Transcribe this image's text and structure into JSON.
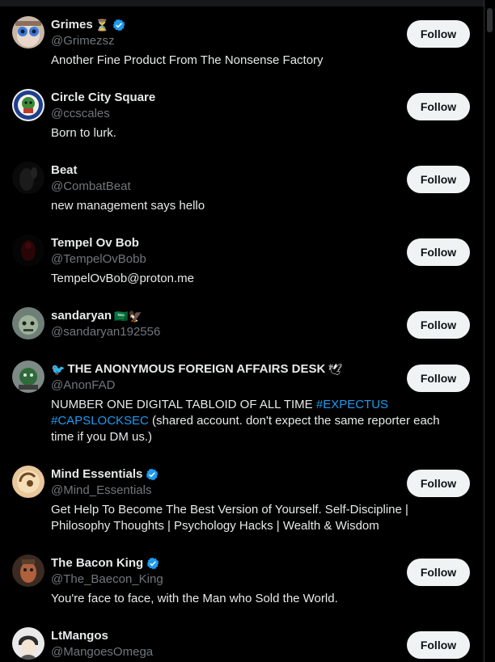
{
  "follow_label": "Follow",
  "colors": {
    "background": "#000000",
    "verified": "#1d9bf0",
    "link": "#1d9bf0",
    "handle": "#71767b",
    "button_bg": "#eff3f4"
  },
  "users": [
    {
      "name": "Grimes",
      "emoji_after": "⏳",
      "verified": true,
      "handle": "@Grimezsz",
      "bio": "Another Fine Product From The Nonsense Factory"
    },
    {
      "name": "Circle City Square",
      "verified": false,
      "handle": "@ccscales",
      "bio": "Born to lurk."
    },
    {
      "name": "Beat",
      "verified": false,
      "handle": "@CombatBeat",
      "bio": "new management says hello"
    },
    {
      "name": "Tempel Ov Bob",
      "verified": false,
      "handle": "@TempelOvBobb",
      "bio": "TempelOvBob@proton.me"
    },
    {
      "name": "sandaryan",
      "emoji_after": "🇸🇦🦅",
      "verified": false,
      "handle": "@sandaryan192556",
      "bio": ""
    },
    {
      "name": "THE ANONYMOUS FOREIGN AFFAIRS DESK",
      "emoji_before": "🐦",
      "emoji_after": "🕊",
      "verified": false,
      "handle": "@AnonFAD",
      "bio_parts": [
        "NUMBER ONE DIGITAL TABLOID OF ALL TIME ",
        "#EXPECTUS",
        " ",
        "#CAPSLOCKSEC",
        " (shared account. don't expect the same reporter each time if you DM us.)"
      ]
    },
    {
      "name": "Mind Essentials",
      "verified": true,
      "handle": "@Mind_Essentials",
      "bio": "Get Help To Become The Best Version of Yourself. Self-Discipline | Philosophy Thoughts | Psychology Hacks | Wealth & Wisdom"
    },
    {
      "name": "The Bacon King",
      "verified": true,
      "handle": "@The_Baecon_King",
      "bio": "You're face to face, with the Man who Sold the World."
    },
    {
      "name": "LtMangos",
      "verified": false,
      "handle": "@MangoesOmega",
      "bio": ""
    }
  ]
}
